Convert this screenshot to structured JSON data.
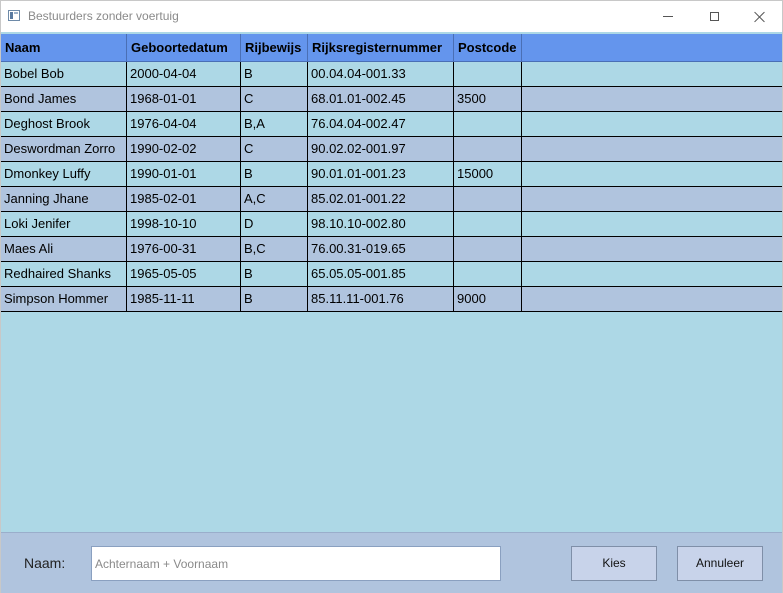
{
  "window": {
    "title": "Bestuurders zonder voertuig"
  },
  "grid": {
    "columns": [
      "Naam",
      "Geboortedatum",
      "Rijbewijs",
      "Rijksregisternummer",
      "Postcode",
      ""
    ],
    "rows": [
      [
        "Bobel Bob",
        "2000-04-04",
        "B",
        "00.04.04-001.33",
        "",
        ""
      ],
      [
        "Bond James",
        "1968-01-01",
        "C",
        "68.01.01-002.45",
        "3500",
        ""
      ],
      [
        "Deghost Brook",
        "1976-04-04",
        "B,A",
        "76.04.04-002.47",
        "",
        ""
      ],
      [
        "Deswordman Zorro",
        "1990-02-02",
        "C",
        "90.02.02-001.97",
        "",
        ""
      ],
      [
        "Dmonkey Luffy",
        "1990-01-01",
        "B",
        "90.01.01-001.23",
        "15000",
        ""
      ],
      [
        "Janning Jhane",
        "1985-02-01",
        "A,C",
        "85.02.01-001.22",
        "",
        ""
      ],
      [
        "Loki Jenifer",
        "1998-10-10",
        "D",
        "98.10.10-002.80",
        "",
        ""
      ],
      [
        "Maes Ali",
        "1976-00-31",
        "B,C",
        "76.00.31-019.65",
        "",
        ""
      ],
      [
        "Redhaired Shanks",
        "1965-05-05",
        "B",
        "65.05.05-001.85",
        "",
        ""
      ],
      [
        "Simpson Hommer",
        "1985-11-11",
        "B",
        "85.11.11-001.76",
        "9000",
        ""
      ]
    ]
  },
  "form": {
    "naam_label": "Naam:",
    "naam_value": "",
    "naam_placeholder": "Achternaam + Voornaam",
    "kies_label": "Kies",
    "annuleer_label": "Annuleer"
  },
  "colors": {
    "header": "#6495ed",
    "row_odd": "#add8e6",
    "row_even": "#b0c4de",
    "panel": "#b0c4de"
  },
  "icons": {
    "app": "window-app-icon",
    "minimize": "minimize-icon",
    "maximize": "maximize-icon",
    "close": "close-icon"
  }
}
